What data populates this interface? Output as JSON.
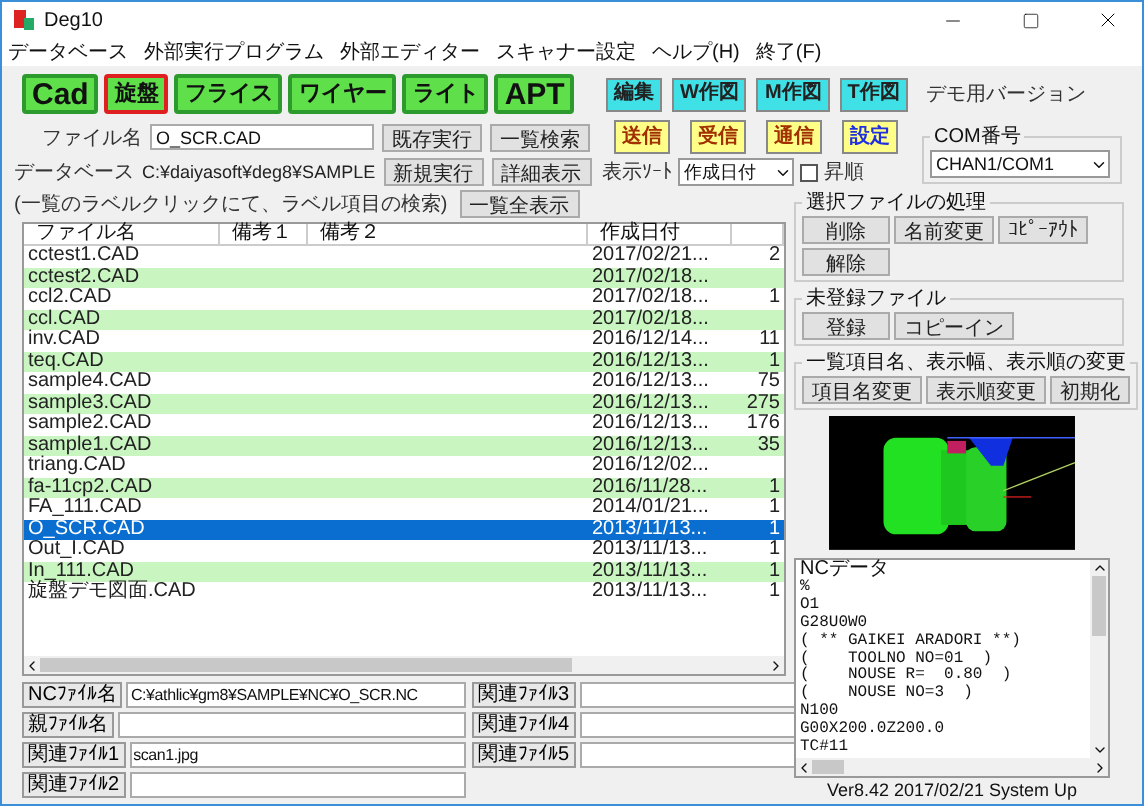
{
  "window": {
    "title": "Deg10"
  },
  "menu": [
    "データベース",
    "外部実行プログラム",
    "外部エディター",
    "スキャナー設定",
    "ヘルプ(H)",
    "終了(F)"
  ],
  "mode_buttons": [
    {
      "label": "Cad",
      "selected": false
    },
    {
      "label": "旋盤",
      "selected": true
    },
    {
      "label": "フライス",
      "selected": false
    },
    {
      "label": "ワイヤー",
      "selected": false
    },
    {
      "label": "ライト",
      "selected": false
    },
    {
      "label": "APT",
      "selected": false
    }
  ],
  "view_buttons": [
    "編集",
    "W作図",
    "M作図",
    "T作図"
  ],
  "comm_buttons": [
    {
      "label": "送信",
      "kind": "normal"
    },
    {
      "label": "受信",
      "kind": "normal"
    },
    {
      "label": "通信",
      "kind": "normal"
    },
    {
      "label": "設定",
      "kind": "accent"
    }
  ],
  "demo_label": "デモ用バージョン",
  "com_port": {
    "legend": "COM番号",
    "value": "CHAN1/COM1"
  },
  "file_name": {
    "label": "ファイル名",
    "value": "O_SCR.CAD"
  },
  "database": {
    "label": "データベース",
    "value": "C:¥daiyasoft¥deg8¥SAMPLE"
  },
  "file_buttons": [
    "既存実行",
    "一覧検索",
    "新規実行",
    "詳細表示"
  ],
  "hint": "(一覧のラベルクリックにて、ラベル項目の検索)",
  "show_all_button": "一覧全表示",
  "sort": {
    "label": "表示ｿｰﾄ",
    "value": "作成日付",
    "ascending": {
      "label": "昇順",
      "checked": false
    }
  },
  "file_list": {
    "columns": [
      "ファイル名",
      "備考１",
      "備考２",
      "作成日付",
      ""
    ],
    "rows": [
      {
        "cells": [
          "cctest1.CAD",
          "",
          "",
          "2017/02/21...",
          "2"
        ],
        "selected": false
      },
      {
        "cells": [
          "cctest2.CAD",
          "",
          "",
          "2017/02/18...",
          ""
        ],
        "selected": false
      },
      {
        "cells": [
          "ccl2.CAD",
          "",
          "",
          "2017/02/18...",
          "1"
        ],
        "selected": false
      },
      {
        "cells": [
          "ccl.CAD",
          "",
          "",
          "2017/02/18...",
          ""
        ],
        "selected": false
      },
      {
        "cells": [
          "inv.CAD",
          "",
          "",
          "2016/12/14...",
          "11"
        ],
        "selected": false
      },
      {
        "cells": [
          "teq.CAD",
          "",
          "",
          "2016/12/13...",
          "1"
        ],
        "selected": false
      },
      {
        "cells": [
          "sample4.CAD",
          "",
          "",
          "2016/12/13...",
          "75"
        ],
        "selected": false
      },
      {
        "cells": [
          "sample3.CAD",
          "",
          "",
          "2016/12/13...",
          "275"
        ],
        "selected": false
      },
      {
        "cells": [
          "sample2.CAD",
          "",
          "",
          "2016/12/13...",
          "176"
        ],
        "selected": false
      },
      {
        "cells": [
          "sample1.CAD",
          "",
          "",
          "2016/12/13...",
          "35"
        ],
        "selected": false
      },
      {
        "cells": [
          "triang.CAD",
          "",
          "",
          "2016/12/02...",
          ""
        ],
        "selected": false
      },
      {
        "cells": [
          "fa-11cp2.CAD",
          "",
          "",
          "2016/11/28...",
          "1"
        ],
        "selected": false
      },
      {
        "cells": [
          "FA_111.CAD",
          "",
          "",
          "2014/01/21...",
          "1"
        ],
        "selected": false
      },
      {
        "cells": [
          "O_SCR.CAD",
          "",
          "",
          "2013/11/13...",
          "1"
        ],
        "selected": true
      },
      {
        "cells": [
          "Out_I.CAD",
          "",
          "",
          "2013/11/13...",
          "1"
        ],
        "selected": false
      },
      {
        "cells": [
          "In_111.CAD",
          "",
          "",
          "2013/11/13...",
          "1"
        ],
        "selected": false
      },
      {
        "cells": [
          "旋盤デモ図面.CAD",
          "",
          "",
          "2013/11/13...",
          "1"
        ],
        "selected": false
      }
    ]
  },
  "related_files": [
    {
      "label": "NCﾌｧｲﾙ名",
      "value": "C:¥athlic¥gm8¥SAMPLE¥NC¥O_SCR.NC"
    },
    {
      "label": "親ﾌｧｲﾙ名"
    },
    {
      "label": "関連ﾌｧｲﾙ1",
      "value": "scan1.jpg"
    },
    {
      "label": "関連ﾌｧｲﾙ2"
    },
    {
      "label": "関連ﾌｧｲﾙ3"
    },
    {
      "label": "関連ﾌｧｲﾙ4"
    },
    {
      "label": "関連ﾌｧｲﾙ5"
    }
  ],
  "selected_file_group": {
    "legend": "選択ファイルの処理",
    "buttons": [
      "削除",
      "名前変更",
      "ｺﾋﾟｰｱｳﾄ",
      "解除"
    ]
  },
  "unregistered_group": {
    "legend": "未登録ファイル",
    "buttons": [
      "登録",
      "コピーイン"
    ]
  },
  "column_group": {
    "legend": "一覧項目名、表示幅、表示順の変更",
    "buttons": [
      "項目名変更",
      "表示順変更",
      "初期化"
    ]
  },
  "nc_data": {
    "title": "NCデータ",
    "lines": [
      "%",
      "O1",
      "G28U0W0",
      "( ** GAIKEI ARADORI **)",
      "(    TOOLNO NO=01  )",
      "(    NOUSE R=  0.80  )",
      "(    NOUSE NO=3  )",
      "N100",
      "G00X200.0Z200.0",
      "TC#11"
    ]
  },
  "version": "Ver8.42  2017/02/21 System Up"
}
